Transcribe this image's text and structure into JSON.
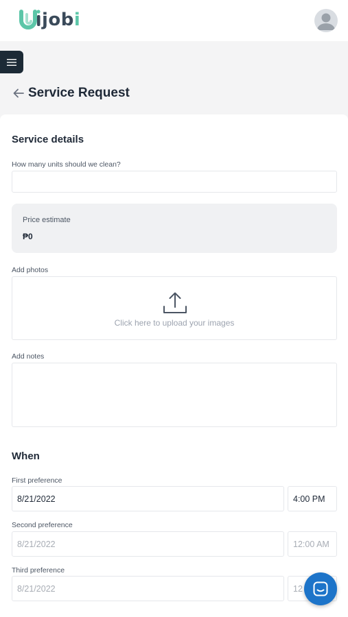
{
  "brand": {
    "logo_text_main": "jobi",
    "logo_text_dot": "i",
    "logo_text_prefix": "jo",
    "logo_text_b": "b"
  },
  "header": {
    "title": "Service Request"
  },
  "service_details": {
    "heading": "Service details",
    "units_label": "How many units should we clean?",
    "units_value": "",
    "price_label": "Price estimate",
    "price_value": "₱0",
    "photos_label": "Add photos",
    "upload_text": "Click here to upload your images",
    "notes_label": "Add notes",
    "notes_value": ""
  },
  "when": {
    "heading": "When",
    "first": {
      "label": "First preference",
      "date": "8/21/2022",
      "time": "4:00 PM"
    },
    "second": {
      "label": "Second preference",
      "date": "8/21/2022",
      "time": "12:00 AM"
    },
    "third": {
      "label": "Third preference",
      "date": "8/21/2022",
      "time": "12"
    }
  },
  "colors": {
    "brand_green": "#5cc6a8",
    "brand_dark": "#3a4a5a",
    "menu_dark": "#1c2a36",
    "chat_blue": "#1d74c9"
  },
  "icons": {
    "menu": "hamburger-icon",
    "back": "arrow-left-icon",
    "upload": "upload-icon",
    "chat": "chat-icon",
    "avatar": "user-avatar-icon"
  }
}
